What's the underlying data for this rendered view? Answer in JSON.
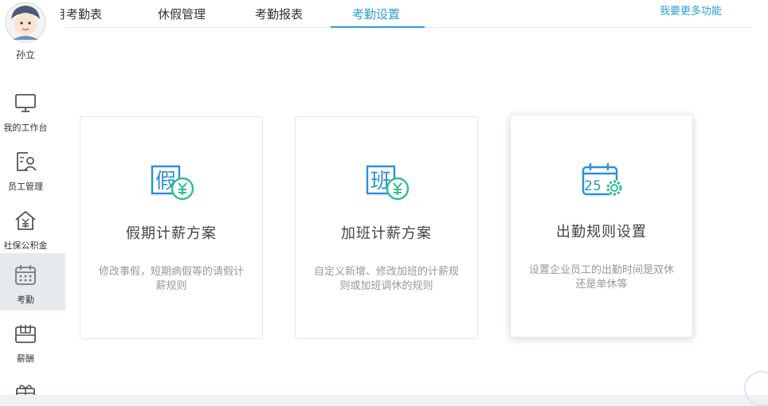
{
  "user": {
    "name": "孙立"
  },
  "nav": [
    {
      "label": "我的工作台",
      "icon": "monitor-icon"
    },
    {
      "label": "员工管理",
      "icon": "employee-icon"
    },
    {
      "label": "社保公积金",
      "icon": "house-yen-icon"
    },
    {
      "label": "考勤",
      "icon": "calendar-icon"
    },
    {
      "label": "薪酬",
      "icon": "wallet-icon"
    },
    {
      "label": "",
      "icon": "gift-icon"
    }
  ],
  "tabs": [
    {
      "label": "月考勤表"
    },
    {
      "label": "休假管理"
    },
    {
      "label": "考勤报表"
    },
    {
      "label": "考勤设置"
    }
  ],
  "more_link": "我要更多功能",
  "cards": [
    {
      "title": "假期计薪方案",
      "desc": "修改事假，短期病假等的请假计薪规则",
      "icon": "leave-pay-icon"
    },
    {
      "title": "加班计薪方案",
      "desc": "自定义新增、修改加班的计薪规则或加班调休的规则",
      "icon": "overtime-pay-icon"
    },
    {
      "title": "出勤规则设置",
      "desc": "设置企业员工的出勤时间是双休还是单休等",
      "icon": "attendance-settings-icon"
    }
  ],
  "colors": {
    "accent": "#2c9fd6",
    "icon_blue": "#2b8fd8",
    "icon_green": "#2fbf8c"
  }
}
